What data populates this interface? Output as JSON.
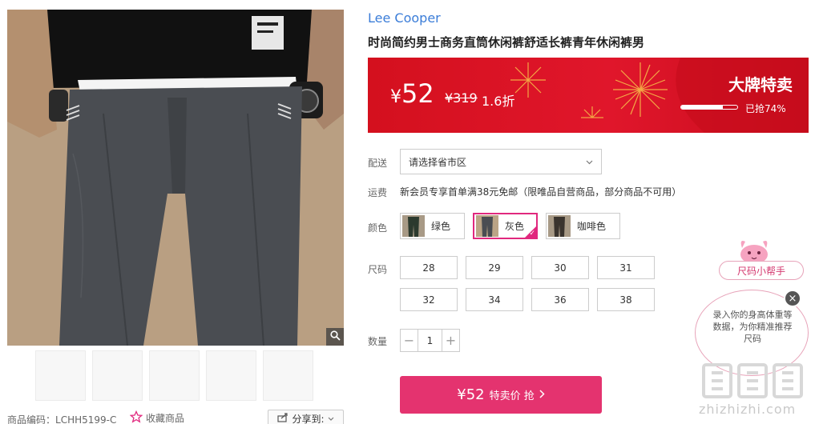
{
  "gallery": {
    "zoom_icon": "magnifier-icon",
    "thumbnail_count": 5,
    "product_code_label": "商品编码：",
    "product_code": "LCHH5199-C",
    "favorite_label": "收藏商品",
    "favorite_icon": "star-outline-icon",
    "share_label": "分享到:",
    "share_icon": "share-icon"
  },
  "product": {
    "brand": "Lee Cooper",
    "title": "时尚简约男士商务直筒休闲裤舒适长裤青年休闲裤男"
  },
  "price_banner": {
    "currency_symbol": "¥",
    "price": "52",
    "original_price": "¥319",
    "discount": "1.6折",
    "sale_title": "大牌特卖",
    "sold_percent": 74,
    "sold_text": "已抢74%",
    "colors": {
      "banner_red": "#d4101e",
      "firework_gold": "#f8c44a"
    }
  },
  "delivery": {
    "label": "配送",
    "placeholder": "请选择省市区",
    "dropdown_icon": "chevron-down-icon"
  },
  "shipping": {
    "label": "运费",
    "text": "新会员专享首单满38元免邮（限唯品自营商品，部分商品不可用）"
  },
  "colors": {
    "label": "颜色",
    "options": [
      {
        "name": "绿色",
        "selected": false
      },
      {
        "name": "灰色",
        "selected": true
      },
      {
        "name": "咖啡色",
        "selected": false
      }
    ],
    "accent": "#e1287e"
  },
  "sizes": {
    "label": "尺码",
    "options": [
      "28",
      "29",
      "30",
      "31",
      "32",
      "34",
      "36",
      "38"
    ]
  },
  "quantity": {
    "label": "数量",
    "value": "1",
    "minus": "−",
    "plus": "+"
  },
  "buy": {
    "price": "¥52",
    "label": "特卖价 抢",
    "arrow_icon": "chevron-right-icon",
    "color": "#e4336f"
  },
  "size_helper": {
    "button_label": "尺码小帮手",
    "bubble_text": "录入你的身高体重等数据，为你精准推荐尺码",
    "close_label": "×",
    "mascot_icon": "pink-mascot-icon"
  },
  "watermark": {
    "logo_text": "值值值",
    "url": "zhizhizhi.com"
  }
}
